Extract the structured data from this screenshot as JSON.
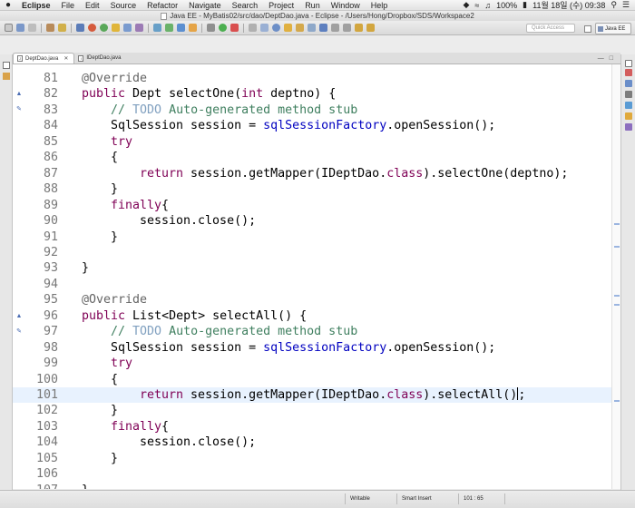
{
  "menubar": {
    "apple": "",
    "items": [
      "Eclipse",
      "File",
      "Edit",
      "Source",
      "Refactor",
      "Navigate",
      "Search",
      "Project",
      "Run",
      "Window",
      "Help"
    ],
    "battery": "100%",
    "datetime": "11월 18일 (수)  09:38"
  },
  "window": {
    "title": "Java EE - MyBatis02/src/dao/DeptDao.java - Eclipse - /Users/Hong/Dropbox/SDS/Workspace2"
  },
  "toolbar": {
    "quick_access_placeholder": "Quick Access",
    "perspective_label": "Java EE"
  },
  "tabs": [
    {
      "label": "DeptDao.java",
      "active": true,
      "close": "✕"
    },
    {
      "label": "IDeptDao.java",
      "active": false
    }
  ],
  "editor": {
    "lines": [
      {
        "n": "81",
        "tokens": [
          [
            "ann",
            "@Override"
          ]
        ]
      },
      {
        "n": "82",
        "tokens": [
          [
            "kw",
            "public"
          ],
          [
            "",
            " Dept selectOne("
          ],
          [
            "kw",
            "int"
          ],
          [
            "",
            " deptno) {"
          ]
        ]
      },
      {
        "n": "83",
        "tokens": [
          [
            "cm",
            "// "
          ],
          [
            "todo",
            "TODO"
          ],
          [
            "cm",
            " Auto-generated method stub"
          ]
        ]
      },
      {
        "n": "84",
        "tokens": [
          [
            "",
            "SqlSession session = "
          ],
          [
            "fld",
            "sqlSessionFactory"
          ],
          [
            "",
            ".openSession();"
          ]
        ]
      },
      {
        "n": "85",
        "tokens": [
          [
            "kw",
            "try"
          ]
        ]
      },
      {
        "n": "86",
        "tokens": [
          [
            "",
            "{"
          ]
        ]
      },
      {
        "n": "87",
        "tokens": [
          [
            "kw",
            "return"
          ],
          [
            "",
            " session.getMapper(IDeptDao."
          ],
          [
            "kw",
            "class"
          ],
          [
            "",
            ").selectOne(deptno);"
          ]
        ]
      },
      {
        "n": "88",
        "tokens": [
          [
            "",
            "}"
          ]
        ]
      },
      {
        "n": "89",
        "tokens": [
          [
            "kw",
            "finally"
          ],
          [
            "",
            "{"
          ]
        ]
      },
      {
        "n": "90",
        "tokens": [
          [
            "",
            "session.close();"
          ]
        ]
      },
      {
        "n": "91",
        "tokens": [
          [
            "",
            "}"
          ]
        ]
      },
      {
        "n": "92",
        "tokens": []
      },
      {
        "n": "93",
        "tokens": [
          [
            "",
            "}"
          ]
        ]
      },
      {
        "n": "94",
        "tokens": []
      },
      {
        "n": "95",
        "tokens": [
          [
            "ann",
            "@Override"
          ]
        ]
      },
      {
        "n": "96",
        "tokens": [
          [
            "kw",
            "public"
          ],
          [
            "",
            " List<Dept> selectAll() {"
          ]
        ]
      },
      {
        "n": "97",
        "tokens": [
          [
            "cm",
            "// "
          ],
          [
            "todo",
            "TODO"
          ],
          [
            "cm",
            " Auto-generated method stub"
          ]
        ]
      },
      {
        "n": "98",
        "tokens": [
          [
            "",
            "SqlSession session = "
          ],
          [
            "fld",
            "sqlSessionFactory"
          ],
          [
            "",
            ".openSession();"
          ]
        ]
      },
      {
        "n": "99",
        "tokens": [
          [
            "kw",
            "try"
          ]
        ]
      },
      {
        "n": "100",
        "tokens": [
          [
            "",
            "{"
          ]
        ]
      },
      {
        "n": "101",
        "tokens": [
          [
            "kw",
            "return"
          ],
          [
            "",
            " session.getMapper(IDeptDao."
          ],
          [
            "kw",
            "class"
          ],
          [
            "",
            ").selectAll()"
          ],
          [
            "caret",
            ""
          ],
          [
            "",
            ";"
          ]
        ]
      },
      {
        "n": "102",
        "tokens": [
          [
            "",
            "}"
          ]
        ]
      },
      {
        "n": "103",
        "tokens": [
          [
            "kw",
            "finally"
          ],
          [
            "",
            "{"
          ]
        ]
      },
      {
        "n": "104",
        "tokens": [
          [
            "",
            "session.close();"
          ]
        ]
      },
      {
        "n": "105",
        "tokens": [
          [
            "",
            "}"
          ]
        ]
      },
      {
        "n": "106",
        "tokens": []
      },
      {
        "n": "107",
        "tokens": [
          [
            "",
            "}"
          ]
        ]
      }
    ],
    "current_line": "101"
  },
  "statusbar": {
    "mode": "Writable",
    "insert": "Smart Insert",
    "position": "101 : 65"
  }
}
